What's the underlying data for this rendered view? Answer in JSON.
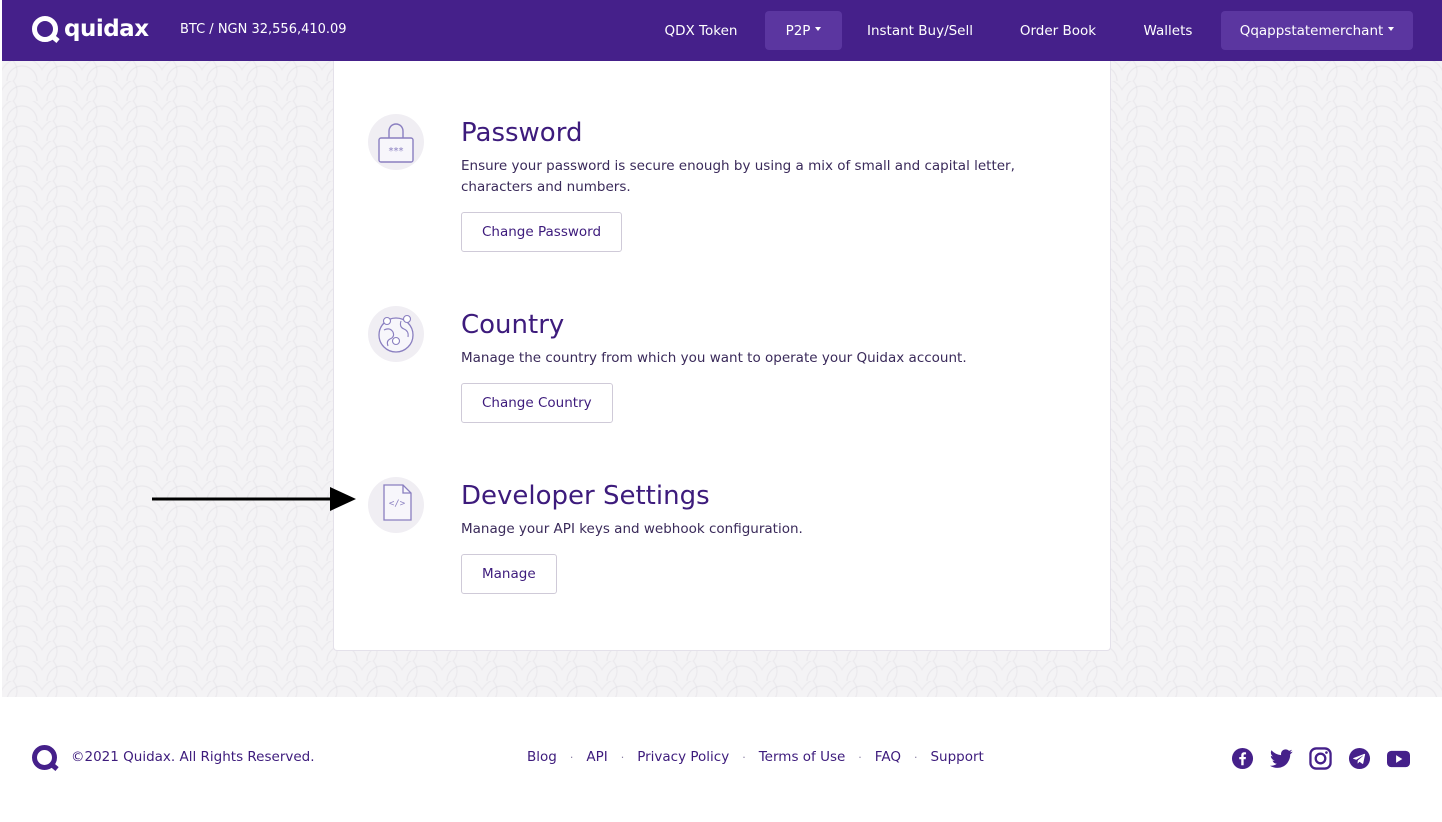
{
  "header": {
    "logo_text": "quidax",
    "ticker": "BTC / NGN 32,556,410.09",
    "nav": [
      {
        "label": "QDX Token"
      },
      {
        "label": "P2P"
      },
      {
        "label": "Instant Buy/Sell"
      },
      {
        "label": "Order Book"
      },
      {
        "label": "Wallets"
      },
      {
        "label": "Qqappstatemerchant"
      }
    ]
  },
  "sections": [
    {
      "title": "Password",
      "description": "Ensure your password is secure enough by using a mix of small and capital letter, characters and numbers.",
      "button": "Change Password",
      "icon": "lock-icon"
    },
    {
      "title": "Country",
      "description": "Manage the country from which you want to operate your Quidax account.",
      "button": "Change Country",
      "icon": "globe-icon"
    },
    {
      "title": "Developer Settings",
      "description": "Manage your API keys and webhook configuration.",
      "button": "Manage",
      "icon": "code-file-icon"
    }
  ],
  "footer": {
    "copyright": "©2021 Quidax. All Rights Reserved.",
    "links": [
      "Blog",
      "API",
      "Privacy Policy",
      "Terms of Use",
      "FAQ",
      "Support"
    ],
    "social": [
      "facebook-icon",
      "twitter-icon",
      "instagram-icon",
      "telegram-icon",
      "youtube-icon"
    ]
  },
  "colors": {
    "brand": "#45208a",
    "brand_active": "#5b36a0",
    "text_dark": "#3d1b7c"
  }
}
